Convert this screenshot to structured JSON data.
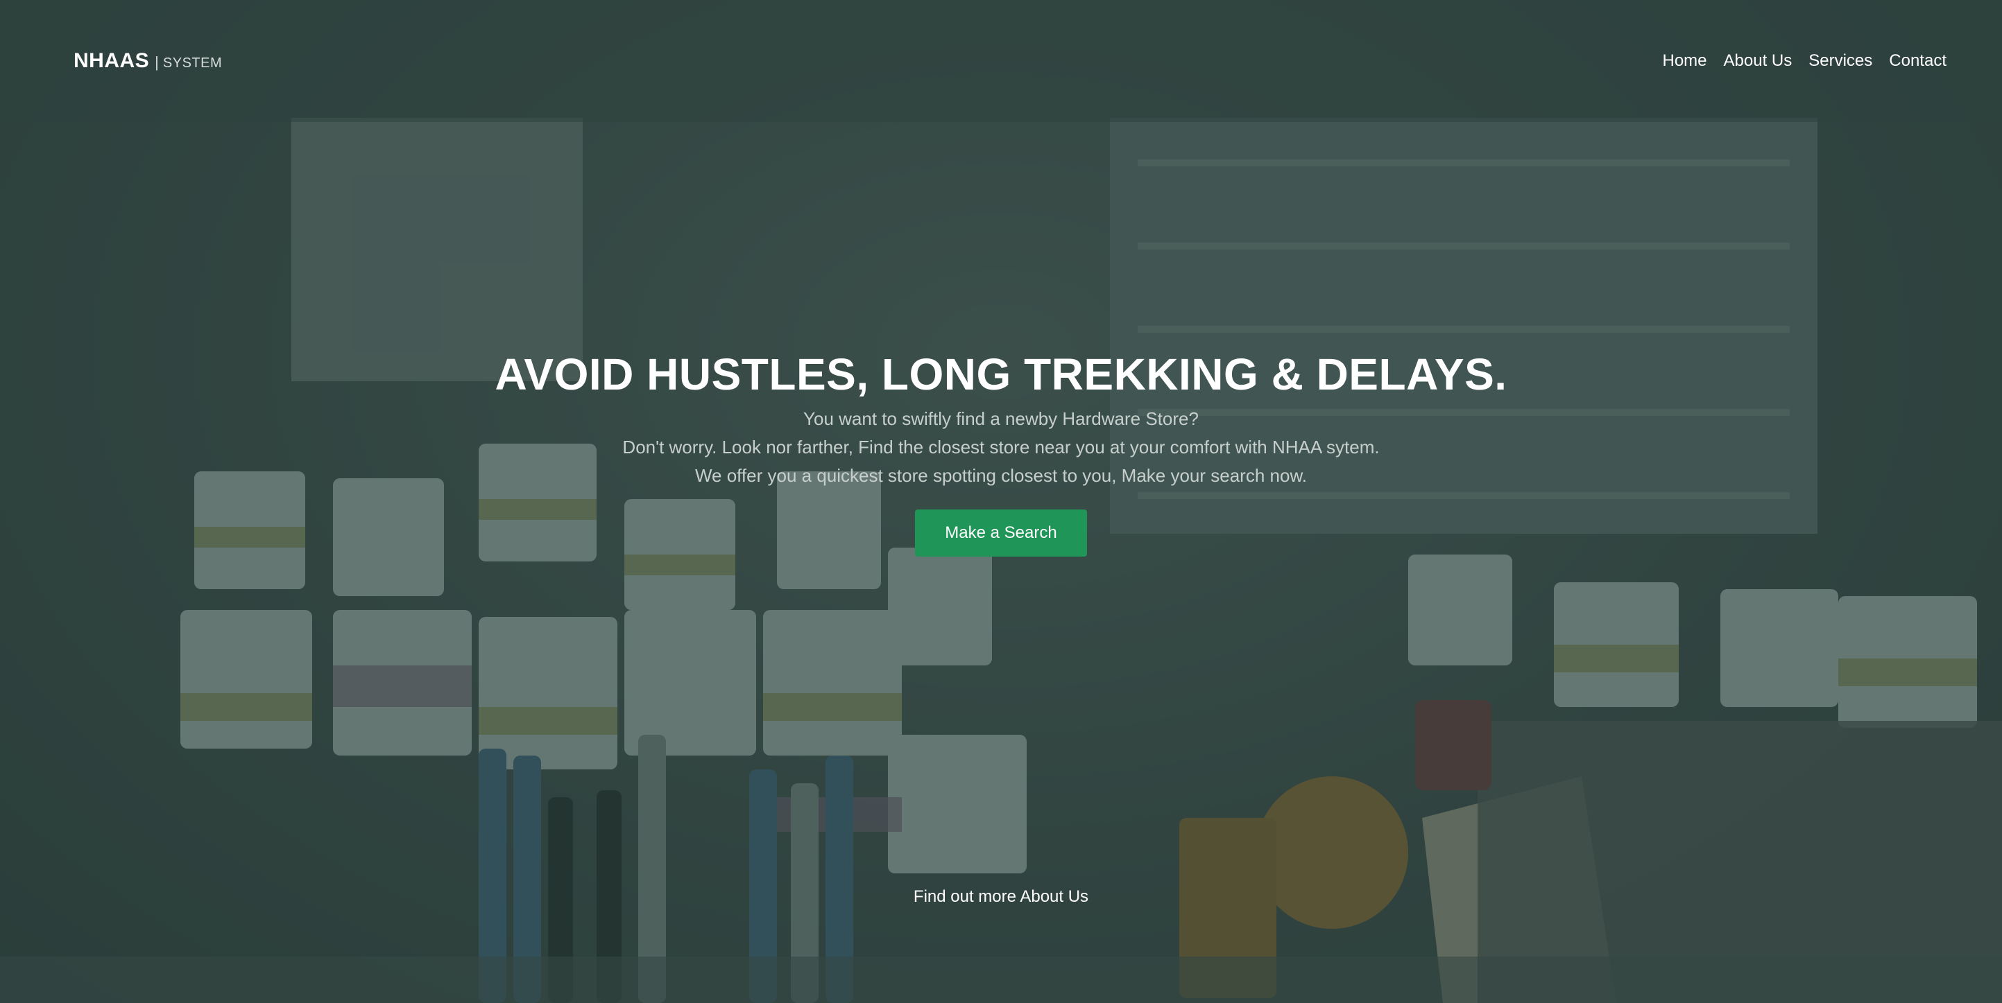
{
  "brand": {
    "name": "NHAAS",
    "separator": "|",
    "sub": "SYSTEM"
  },
  "nav": {
    "items": [
      "Home",
      "About Us",
      "Services",
      "Contact"
    ]
  },
  "hero": {
    "headline": "AVOID HUSTLES, LONG TREKKING & DELAYS.",
    "lines": [
      "You want to swiftly find a newby Hardware Store?",
      "Don't worry. Look nor farther, Find the closest store near you at your comfort with NHAA sytem.",
      "We offer you a quickest store spotting closest to you, Make your search now."
    ],
    "cta_label": "Make a Search",
    "about_link": "Find out more About Us"
  },
  "colors": {
    "cta": "#1f9557",
    "overlay": "#28403c"
  }
}
